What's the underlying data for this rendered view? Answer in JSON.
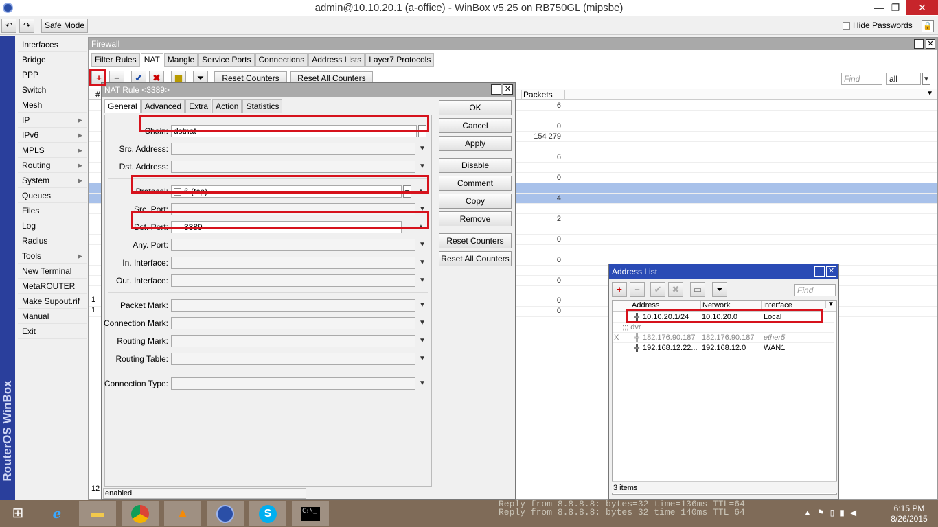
{
  "window": {
    "title": "admin@10.10.20.1 (a-office) - WinBox v5.25 on RB750GL (mipsbe)",
    "minimize": "—",
    "restore": "❐",
    "close": "✕"
  },
  "toolbar": {
    "undo": "↶",
    "redo": "↷",
    "safe_mode": "Safe Mode",
    "hide_passwords": "Hide Passwords"
  },
  "brand": "RouterOS WinBox",
  "menu": [
    {
      "label": "Interfaces",
      "sub": false
    },
    {
      "label": "Bridge",
      "sub": false
    },
    {
      "label": "PPP",
      "sub": false
    },
    {
      "label": "Switch",
      "sub": false
    },
    {
      "label": "Mesh",
      "sub": false
    },
    {
      "label": "IP",
      "sub": true
    },
    {
      "label": "IPv6",
      "sub": true
    },
    {
      "label": "MPLS",
      "sub": true
    },
    {
      "label": "Routing",
      "sub": true
    },
    {
      "label": "System",
      "sub": true
    },
    {
      "label": "Queues",
      "sub": false
    },
    {
      "label": "Files",
      "sub": false
    },
    {
      "label": "Log",
      "sub": false
    },
    {
      "label": "Radius",
      "sub": false
    },
    {
      "label": "Tools",
      "sub": true
    },
    {
      "label": "New Terminal",
      "sub": false
    },
    {
      "label": "MetaROUTER",
      "sub": false
    },
    {
      "label": "Make Supout.rif",
      "sub": false
    },
    {
      "label": "Manual",
      "sub": false
    },
    {
      "label": "Exit",
      "sub": false
    }
  ],
  "firewall": {
    "title": "Firewall",
    "tabs": [
      "Filter Rules",
      "NAT",
      "Mangle",
      "Service Ports",
      "Connections",
      "Address Lists",
      "Layer7 Protocols"
    ],
    "active_tab": "NAT",
    "reset_counters": "Reset Counters",
    "reset_all_counters": "Reset All Counters",
    "find_placeholder": "Find",
    "filter_value": "all",
    "packets_header": "Packets",
    "hash_header": "#",
    "packets": [
      "6",
      "0",
      "154 279",
      "6",
      "0",
      "",
      "4",
      "2",
      "0",
      "0",
      "0",
      "0",
      "0"
    ],
    "row_numbers": [
      "1",
      "1"
    ],
    "count_prefix": "12"
  },
  "nat_rule": {
    "title": "NAT Rule <3389>",
    "tabs": [
      "General",
      "Advanced",
      "Extra",
      "Action",
      "Statistics"
    ],
    "active_tab": "General",
    "fields": {
      "chain": {
        "label": "Chain:",
        "value": "dstnat"
      },
      "src_address": {
        "label": "Src. Address:",
        "value": ""
      },
      "dst_address": {
        "label": "Dst. Address:",
        "value": ""
      },
      "protocol": {
        "label": "Protocol:",
        "value": "6 (tcp)"
      },
      "src_port": {
        "label": "Src. Port:",
        "value": ""
      },
      "dst_port": {
        "label": "Dst. Port:",
        "value": "3389"
      },
      "any_port": {
        "label": "Any. Port:",
        "value": ""
      },
      "in_interface": {
        "label": "In. Interface:",
        "value": ""
      },
      "out_interface": {
        "label": "Out. Interface:",
        "value": ""
      },
      "packet_mark": {
        "label": "Packet Mark:",
        "value": ""
      },
      "connection_mark": {
        "label": "Connection Mark:",
        "value": ""
      },
      "routing_mark": {
        "label": "Routing Mark:",
        "value": ""
      },
      "routing_table": {
        "label": "Routing Table:",
        "value": ""
      },
      "connection_type": {
        "label": "Connection Type:",
        "value": ""
      }
    },
    "buttons": {
      "ok": "OK",
      "cancel": "Cancel",
      "apply": "Apply",
      "disable": "Disable",
      "comment": "Comment",
      "copy": "Copy",
      "remove": "Remove",
      "reset_counters": "Reset Counters",
      "reset_all_counters": "Reset All Counters"
    },
    "status": "enabled"
  },
  "address_list": {
    "title": "Address List",
    "find_placeholder": "Find",
    "columns": [
      "Address",
      "Network",
      "Interface"
    ],
    "rows": [
      {
        "flag": "",
        "address": "10.10.20.1/24",
        "network": "10.10.20.0",
        "interface": "Local",
        "comment": ""
      },
      {
        "flag": "",
        "address": "",
        "network": "",
        "interface": "",
        "comment": ";;; dvr"
      },
      {
        "flag": "X",
        "address": "182.176.90.187",
        "network": "182.176.90.187",
        "interface": "ether5",
        "comment": ""
      },
      {
        "flag": "",
        "address": "192.168.12.22...",
        "network": "192.168.12.0",
        "interface": "WAN1",
        "comment": ""
      }
    ],
    "item_count": "3 items"
  },
  "console": [
    "Reply from 8.8.8.8: bytes=32 time=136ms TTL=64",
    "Reply from 8.8.8.8: bytes=32 time=140ms TTL=64"
  ],
  "taskbar": {
    "time": "6:15 PM",
    "date": "8/26/2015",
    "cmd_label": "C:\\_"
  },
  "colors": {
    "highlight": "#d6121c",
    "selection": "#a8c1ea",
    "brand_strip": "#2a3f9c",
    "taskbar": "#7f6b58"
  }
}
